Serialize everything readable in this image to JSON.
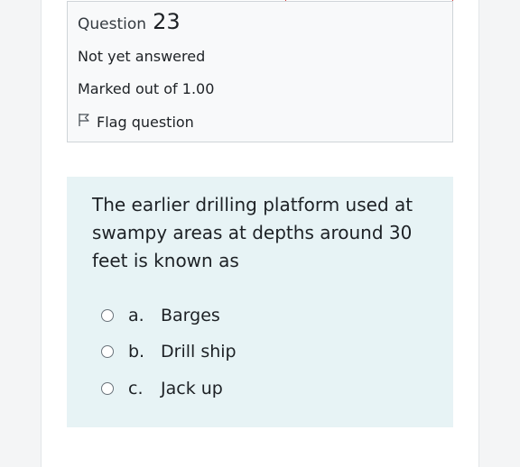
{
  "question_info": {
    "label": "Question",
    "number": "23",
    "status": "Not yet answered",
    "grade": "Marked out of 1.00",
    "flag_label": "Flag question"
  },
  "question": {
    "text": "The earlier drilling platform used at swampy areas at depths around 30 feet is known as",
    "answers": [
      {
        "letter": "a.",
        "label": "Barges"
      },
      {
        "letter": "b.",
        "label": "Drill ship"
      },
      {
        "letter": "c.",
        "label": "Jack up"
      }
    ]
  },
  "colors": {
    "info_card_bg": "#f8f9fa",
    "content_card_bg": "#e7f3f5",
    "accent_red": "#d33a3a"
  },
  "icons": {
    "flag": "flag-icon",
    "radio": "radio-unchecked-icon"
  }
}
